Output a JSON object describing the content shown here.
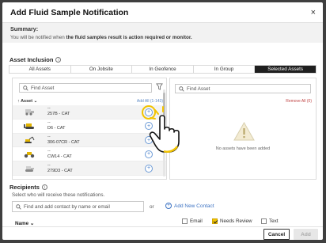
{
  "modal": {
    "title": "Add Fluid Sample Notification",
    "close_symbol": "×"
  },
  "summary": {
    "label": "Summary:",
    "text_prefix": "You will be notified when ",
    "text_bold": "the fluid samples result is action required or monitor."
  },
  "asset_inclusion": {
    "title": "Asset Inclusion",
    "info_symbol": "i",
    "tabs": [
      {
        "label": "All Assets"
      },
      {
        "label": "On Jobsite"
      },
      {
        "label": "In Geofence"
      },
      {
        "label": "In Group"
      },
      {
        "label": "Selected Assets",
        "active": true
      }
    ]
  },
  "left_panel": {
    "search_placeholder": "Find Asset",
    "column_header": "Asset",
    "sort_arrow": "↑",
    "sort_chevron": "⌄",
    "add_all_label": "Add All (1-143)",
    "add_symbol": "+",
    "assets": [
      {
        "dash": "--",
        "name": "257B - CAT",
        "icon": "skid-steer-icon",
        "highlighted": true
      },
      {
        "dash": "--",
        "name": "D6 - CAT",
        "icon": "dozer-icon"
      },
      {
        "dash": "--",
        "name": "306-07CR - CAT",
        "icon": "excavator-icon"
      },
      {
        "dash": "--",
        "name": "CW14 - CAT",
        "icon": "compactor-icon"
      },
      {
        "dash": "--",
        "name": "279D3 - CAT",
        "icon": "track-loader-icon"
      }
    ]
  },
  "right_panel": {
    "search_placeholder": "Find Asset",
    "remove_all_label": "Remove All (0)",
    "empty_message": "No assets have been added",
    "empty_icon": "warning-icon"
  },
  "recipients": {
    "title": "Recipients",
    "subtitle": "Select who will receive these notifications.",
    "search_placeholder": "Find and add contact by name or email",
    "or_text": "or",
    "add_contact_label": "Add New Contact",
    "name_column": "Name",
    "name_sort": "⌄",
    "options": [
      {
        "label": "Email",
        "checked": false
      },
      {
        "label": "Needs Review",
        "checked": true
      },
      {
        "label": "Text",
        "checked": false
      }
    ]
  },
  "footer": {
    "cancel_label": "Cancel",
    "add_label": "Add"
  },
  "colors": {
    "accent_yellow": "#f2c300",
    "link_blue": "#3d73c3",
    "remove_red": "#c04545",
    "active_tab": "#1f1f1f"
  }
}
